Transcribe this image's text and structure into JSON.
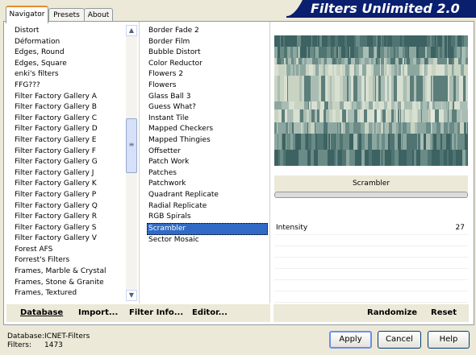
{
  "tabs": [
    {
      "label": "Navigator"
    },
    {
      "label": "Presets"
    },
    {
      "label": "About"
    }
  ],
  "banner": {
    "title": "Filters Unlimited 2.0"
  },
  "categories": [
    "Distort",
    "Déformation",
    "Edges, Round",
    "Edges, Square",
    "enki's filters",
    "FFG???",
    "Filter Factory Gallery A",
    "Filter Factory Gallery B",
    "Filter Factory Gallery C",
    "Filter Factory Gallery D",
    "Filter Factory Gallery E",
    "Filter Factory Gallery F",
    "Filter Factory Gallery G",
    "Filter Factory Gallery J",
    "Filter Factory Gallery K",
    "Filter Factory Gallery P",
    "Filter Factory Gallery Q",
    "Filter Factory Gallery R",
    "Filter Factory Gallery S",
    "Filter Factory Gallery V",
    "Forest AFS",
    "Forrest's Filters",
    "Frames, Marble & Crystal",
    "Frames, Stone & Granite",
    "Frames, Textured"
  ],
  "filters": [
    "Border Fade 2",
    "Border Film",
    "Bubble Distort",
    "Color Reductor",
    "Flowers 2",
    "Flowers",
    "Glass Ball 3",
    "Guess What?",
    "Instant Tile",
    "Mapped Checkers",
    "Mapped Thingies",
    "Offsetter",
    "Patch Work",
    "Patches",
    "Patchwork",
    "Quadrant Replicate",
    "Radial Replicate",
    "RGB Spirals",
    "Scrambler",
    "Sector Mosaic"
  ],
  "selected_filter": "Scrambler",
  "filter_name": "Scrambler",
  "params": [
    {
      "label": "Intensity",
      "value": "27"
    }
  ],
  "toolbar": {
    "database": "Database",
    "import": "Import...",
    "filter_info": "Filter Info...",
    "editor": "Editor...",
    "randomize": "Randomize",
    "reset": "Reset"
  },
  "status": {
    "db_label": "Database:",
    "db_value": "ICNET-Filters",
    "filters_label": "Filters:",
    "filters_value": "1473"
  },
  "buttons": {
    "apply": "Apply",
    "cancel": "Cancel",
    "help": "Help"
  },
  "colors": {
    "banner": "#0a1f6e",
    "selection": "#316ac5",
    "preview_dark": "#3d6262",
    "preview_light": "#c9d3c2"
  }
}
